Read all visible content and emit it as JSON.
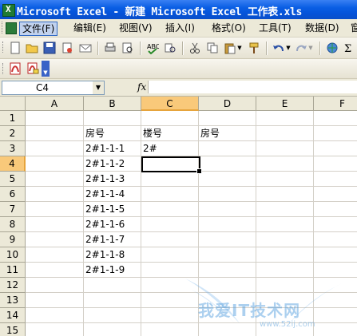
{
  "window": {
    "title": "Microsoft Excel - 新建 Microsoft Excel 工作表.xls"
  },
  "menu": {
    "items": [
      "文件(F)",
      "编辑(E)",
      "视图(V)",
      "插入(I)",
      "格式(O)",
      "工具(T)",
      "数据(D)",
      "窗"
    ]
  },
  "formula_bar": {
    "name_box": "C4",
    "fx_label": "fx",
    "content": ""
  },
  "sheet": {
    "columns": [
      "A",
      "B",
      "C",
      "D",
      "E",
      "F"
    ],
    "rows": [
      "1",
      "2",
      "3",
      "4",
      "5",
      "6",
      "7",
      "8",
      "9",
      "10",
      "11",
      "12",
      "13",
      "14",
      "15"
    ],
    "selected_cell": "C4",
    "cells": {
      "B2": "房号",
      "C2": "楼号",
      "D2": "房号",
      "B3": "2#1-1-1",
      "C3": "2#",
      "B4": "2#1-1-2",
      "B5": "2#1-1-3",
      "B6": "2#1-1-4",
      "B7": "2#1-1-5",
      "B8": "2#1-1-6",
      "B9": "2#1-1-7",
      "B10": "2#1-1-8",
      "B11": "2#1-1-9"
    }
  },
  "watermark": {
    "text": "我爱IT技术网",
    "url": "www.52ij.com"
  }
}
